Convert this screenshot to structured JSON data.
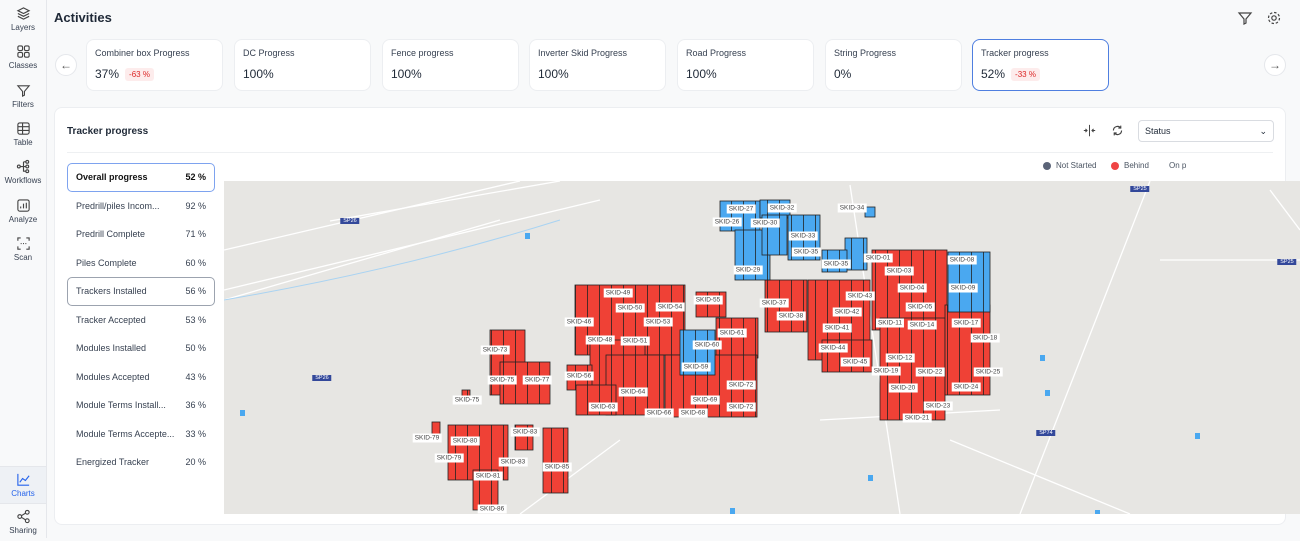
{
  "sidebar": {
    "items": [
      {
        "label": "Layers",
        "icon": "layers-icon"
      },
      {
        "label": "Classes",
        "icon": "grid-icon"
      },
      {
        "label": "Filters",
        "icon": "filter-icon"
      },
      {
        "label": "Table",
        "icon": "table-icon"
      },
      {
        "label": "Workflows",
        "icon": "workflow-icon"
      },
      {
        "label": "Analyze",
        "icon": "chart-box-icon"
      },
      {
        "label": "Scan",
        "icon": "scan-icon"
      }
    ],
    "bottom": [
      {
        "label": "Charts",
        "icon": "line-chart-icon",
        "active": true
      },
      {
        "label": "Sharing",
        "icon": "share-icon"
      }
    ]
  },
  "header": {
    "title": "Activities"
  },
  "cards": [
    {
      "label": "Combiner box Progress",
      "value": "37%",
      "delta": "-63 %"
    },
    {
      "label": "DC Progress",
      "value": "100%"
    },
    {
      "label": "Fence progress",
      "value": "100%"
    },
    {
      "label": "Inverter Skid Progress",
      "value": "100%"
    },
    {
      "label": "Road Progress",
      "value": "100%"
    },
    {
      "label": "String Progress",
      "value": "0%"
    },
    {
      "label": "Tracker progress",
      "value": "52%",
      "delta": "-33 %",
      "selected": true
    }
  ],
  "panel": {
    "title": "Tracker progress",
    "status_select": "Status",
    "legend": [
      {
        "label": "Not Started",
        "color": "#5b6478"
      },
      {
        "label": "Behind",
        "color": "#ef4444"
      },
      {
        "label": "On p",
        "color": "#eab308"
      }
    ],
    "list": [
      {
        "label": "Overall progress",
        "value": "52 %"
      },
      {
        "label": "Predrill/piles Incom...",
        "value": "92 %"
      },
      {
        "label": "Predrill Complete",
        "value": "71 %"
      },
      {
        "label": "Piles Complete",
        "value": "60 %"
      },
      {
        "label": "Trackers Installed",
        "value": "56 %"
      },
      {
        "label": "Tracker Accepted",
        "value": "53 %"
      },
      {
        "label": "Modules Installed",
        "value": "50 %"
      },
      {
        "label": "Modules Accepted",
        "value": "43 %"
      },
      {
        "label": "Module Terms Install...",
        "value": "36 %"
      },
      {
        "label": "Module Terms Accepte...",
        "value": "33 %"
      },
      {
        "label": "Energized Tracker",
        "value": "20 %"
      }
    ]
  },
  "map": {
    "colors": {
      "behind": "#ef4136",
      "blue": "#4aa8f0",
      "background": "#e7e6e3"
    },
    "roads": [
      "SP26",
      "SP26",
      "SP25",
      "SP25",
      "SP74"
    ],
    "skids": [
      "SKID-27",
      "SKID-26",
      "SKID-30",
      "SKID-32",
      "SKID-33",
      "SKID-35",
      "SKID-29",
      "SKID-34",
      "SKID-35",
      "SKID-01",
      "SKID-03",
      "SKID-04",
      "SKID-05",
      "SKID-08",
      "SKID-09",
      "SKID-11",
      "SKID-14",
      "SKID-17",
      "SKID-18",
      "SKID-12",
      "SKID-19",
      "SKID-22",
      "SKID-25",
      "SKID-20",
      "SKID-24",
      "SKID-23",
      "SKID-21",
      "SKID-43",
      "SKID-42",
      "SKID-41",
      "SKID-37",
      "SKID-38",
      "SKID-44",
      "SKID-45",
      "SKID-55",
      "SKID-61",
      "SKID-60",
      "SKID-59",
      "SKID-72",
      "SKID-72",
      "SKID-69",
      "SKID-68",
      "SKID-66",
      "SKID-64",
      "SKID-63",
      "SKID-49",
      "SKID-50",
      "SKID-54",
      "SKID-53",
      "SKID-46",
      "SKID-48",
      "SKID-51",
      "SKID-56",
      "SKID-73",
      "SKID-75",
      "SKID-77",
      "SKID-75",
      "SKID-79",
      "SKID-80",
      "SKID-79",
      "SKID-83",
      "SKID-83",
      "SKID-85",
      "SKID-81",
      "SKID-86"
    ]
  }
}
